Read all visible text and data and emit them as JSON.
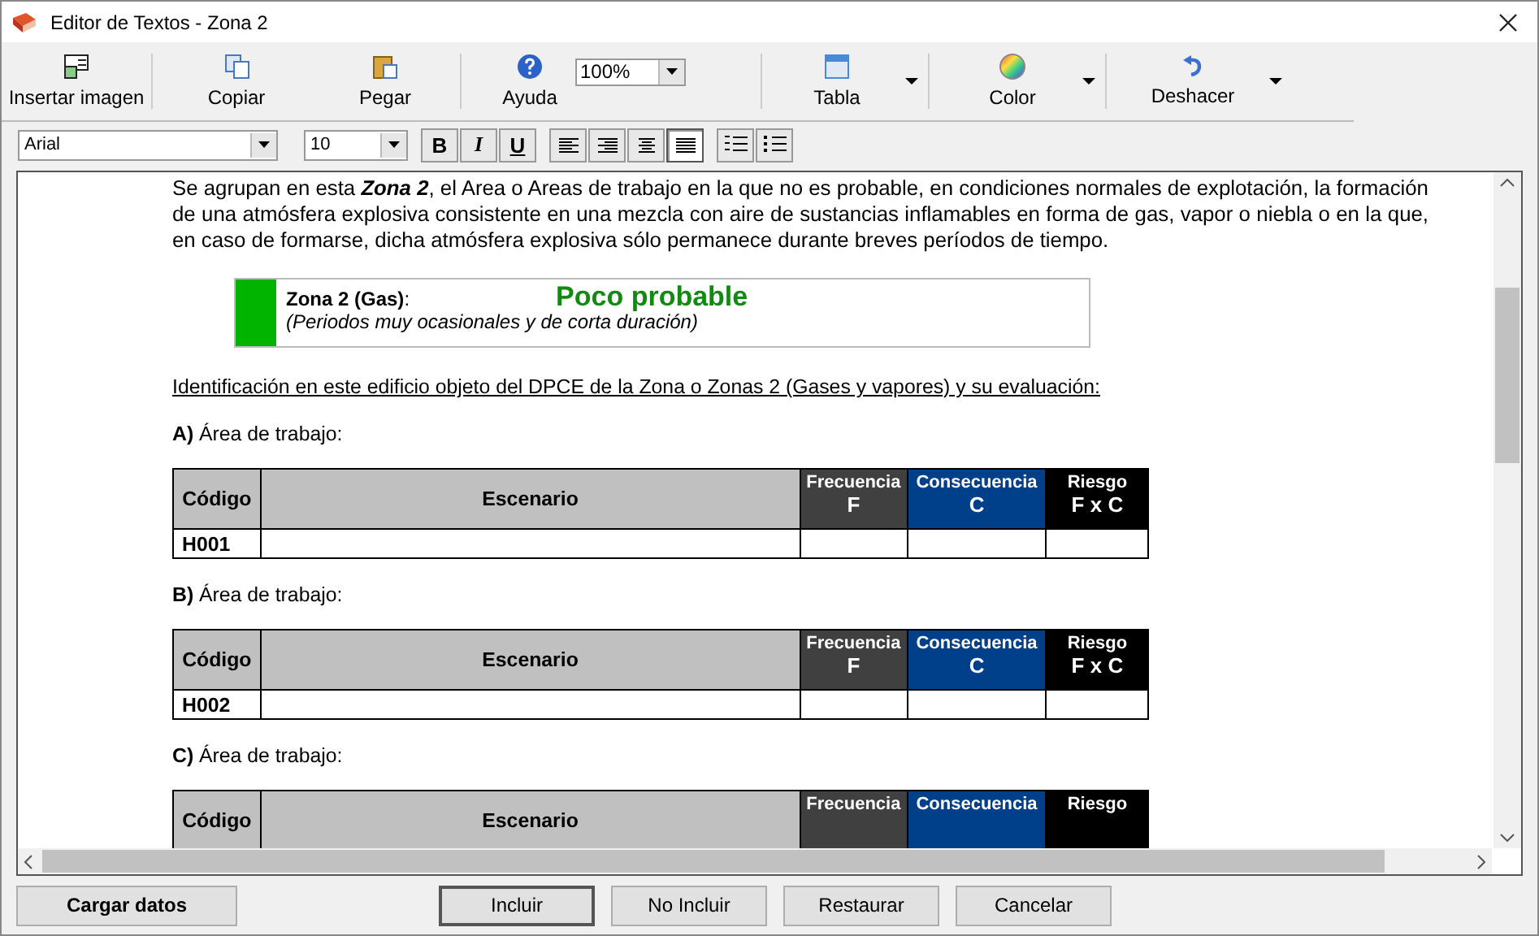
{
  "window": {
    "title": "Editor de Textos - Zona 2"
  },
  "toolbar": [
    {
      "label": "Insertar imagen",
      "kind": "image",
      "has_menu": false
    },
    {
      "label": "Copiar",
      "kind": "copy",
      "has_menu": false
    },
    {
      "label": "Pegar",
      "kind": "paste",
      "has_menu": false
    },
    {
      "label": "Ayuda",
      "kind": "help",
      "has_menu": false
    },
    {
      "label": "100%",
      "kind": "zoom",
      "has_menu": true
    },
    {
      "label": "Tabla",
      "kind": "table",
      "has_menu": true
    },
    {
      "label": "Color",
      "kind": "color",
      "has_menu": true
    },
    {
      "label": "Deshacer",
      "kind": "undo",
      "has_menu": true
    }
  ],
  "format_bar": {
    "font": "Arial",
    "size": "10",
    "styles": [
      {
        "label": "B",
        "kind": "bold",
        "selected": false
      },
      {
        "label": "I",
        "kind": "italic",
        "selected": false
      },
      {
        "label": "U",
        "kind": "underline",
        "selected": false
      }
    ],
    "alignment": [
      {
        "kind": "left",
        "selected": false
      },
      {
        "kind": "right",
        "selected": false
      },
      {
        "kind": "center",
        "selected": false
      },
      {
        "kind": "justify",
        "selected": true
      }
    ],
    "lists": [
      {
        "kind": "numbered",
        "selected": false
      },
      {
        "kind": "bulleted",
        "selected": false
      }
    ]
  },
  "document": {
    "paragraph": "Se agrupan en esta **Zona 2**, el Area o Areas de trabajo en la que no es probable, en condiciones normales de explotación, la formación de una atmósfera explosiva consistente en una mezcla con aire de sustancias inflamables en forma de gas, vapor o niebla o en la que, en caso de formarse, dicha atmósfera explosiva sólo permanece durante breves períodos de tiempo.",
    "zone_box": {
      "color": "#00b400",
      "title": "Zona 2 (Gas)",
      "suffix": ":",
      "note": "(Periodos muy ocasionales y de corta duración)",
      "probability": "Poco probable"
    },
    "heading": "Identificación en este edificio objeto del DPCE de la Zona o Zonas 2 (Gases y vapores) y su evaluación:",
    "sections": [
      {
        "letter": "A)",
        "label": "Área de trabajo:",
        "table": {
          "columns": [
            {
              "label": "Código",
              "color": "#c0c0c0"
            },
            {
              "label": "Escenario",
              "color": "#c0c0c0"
            },
            {
              "label": "Frecuencia",
              "sub": "F",
              "color": "#404040"
            },
            {
              "label": "Consecuencia",
              "sub": "C",
              "color": "#003f8a"
            },
            {
              "label": "Riesgo",
              "sub": "F x C",
              "color": "#000000"
            }
          ],
          "rows": [
            [
              "H001",
              "",
              "",
              "",
              ""
            ]
          ]
        }
      },
      {
        "letter": "B)",
        "label": "Área de trabajo:",
        "table": {
          "columns": [
            {
              "label": "Código",
              "color": "#c0c0c0"
            },
            {
              "label": "Escenario",
              "color": "#c0c0c0"
            },
            {
              "label": "Frecuencia",
              "sub": "F",
              "color": "#404040"
            },
            {
              "label": "Consecuencia",
              "sub": "C",
              "color": "#003f8a"
            },
            {
              "label": "Riesgo",
              "sub": "F x C",
              "color": "#000000"
            }
          ],
          "rows": [
            [
              "H002",
              "",
              "",
              "",
              ""
            ]
          ]
        }
      },
      {
        "letter": "C)",
        "label": "Área de trabajo:",
        "table": {
          "columns": [
            {
              "label": "Código",
              "color": "#c0c0c0"
            },
            {
              "label": "Escenario",
              "color": "#c0c0c0"
            },
            {
              "label": "Frecuencia",
              "color": "#404040"
            },
            {
              "label": "Consecuencia",
              "color": "#003f8a"
            },
            {
              "label": "Riesgo",
              "color": "#000000"
            }
          ]
        }
      }
    ]
  },
  "buttons": [
    {
      "label": "Cargar datos",
      "kind": "load",
      "default": false
    },
    {
      "label": "Incluir",
      "kind": "action",
      "default": true
    },
    {
      "label": "No Incluir",
      "kind": "action",
      "default": false
    },
    {
      "label": "Restaurar",
      "kind": "action",
      "default": false
    },
    {
      "label": "Cancelar",
      "kind": "action",
      "default": false
    }
  ]
}
